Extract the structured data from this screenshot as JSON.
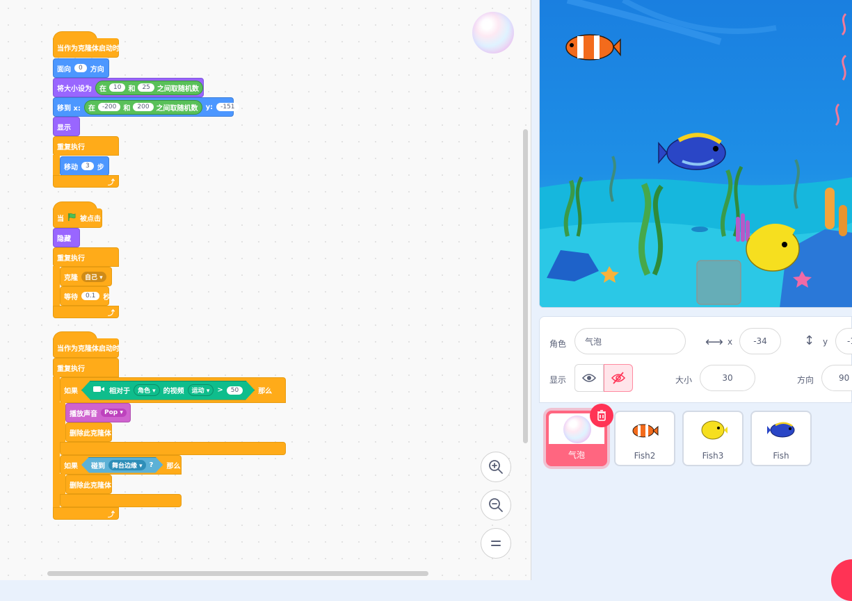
{
  "script1": {
    "hat": "当作为克隆体启动时",
    "point": {
      "label": "面向",
      "value": "0",
      "suffix": "方向"
    },
    "size": {
      "label": "将大小设为",
      "in": "在",
      "a": "10",
      "and": "和",
      "b": "25",
      "between": "之间取随机数"
    },
    "goto": {
      "label": "移到 x:",
      "in": "在",
      "a": "-200",
      "and": "和",
      "b": "200",
      "between": "之间取随机数",
      "ylabel": "y:",
      "y": "-151"
    },
    "show": "显示",
    "forever": "重复执行",
    "move": {
      "label": "移动",
      "value": "3",
      "suffix": "步"
    }
  },
  "script2": {
    "hat_when": "当",
    "hat_clicked": "被点击",
    "hide": "隐藏",
    "forever": "重复执行",
    "clone": {
      "label": "克隆",
      "value": "自己"
    },
    "wait": {
      "label": "等待",
      "value": "0.1",
      "suffix": "秒"
    }
  },
  "script3": {
    "hat": "当作为克隆体启动时",
    "forever": "重复执行",
    "if1": {
      "if": "如果",
      "relative": "相对于",
      "target": "角色",
      "video": "的视频",
      "attr": "运动",
      "op": ">",
      "value": "50",
      "then": "那么"
    },
    "play_sound": {
      "label": "播放声音",
      "value": "Pop"
    },
    "delete1": "删除此克隆体",
    "if2": {
      "if": "如果",
      "touch": "碰到",
      "target": "舞台边缘",
      "q": "?",
      "then": "那么"
    },
    "delete2": "删除此克隆体"
  },
  "sprite_info": {
    "sprite_label": "角色",
    "sprite_name": "气泡",
    "x_label": "x",
    "x_value": "-34",
    "y_label": "y",
    "y_value": "-1",
    "show_label": "显示",
    "size_label": "大小",
    "size_value": "30",
    "direction_label": "方向",
    "direction_value": "90"
  },
  "sprites": [
    {
      "name": "气泡",
      "selected": true
    },
    {
      "name": "Fish2"
    },
    {
      "name": "Fish3"
    },
    {
      "name": "Fish"
    }
  ],
  "colors": {
    "motion": "#4c97ff",
    "looks": "#9966ff",
    "events": "#ffab19",
    "control": "#ffab19",
    "operators": "#59c059",
    "video": "#0fbd8c",
    "sensing": "#5cb1d6",
    "sound": "#cf63cf",
    "selected": "#ff6680"
  },
  "icons": [
    "zoom-in-icon",
    "zoom-out-icon",
    "zoom-reset-icon",
    "green-flag-icon",
    "eye-icon",
    "eye-slash-icon",
    "delete-icon",
    "video-sensing-icon"
  ]
}
